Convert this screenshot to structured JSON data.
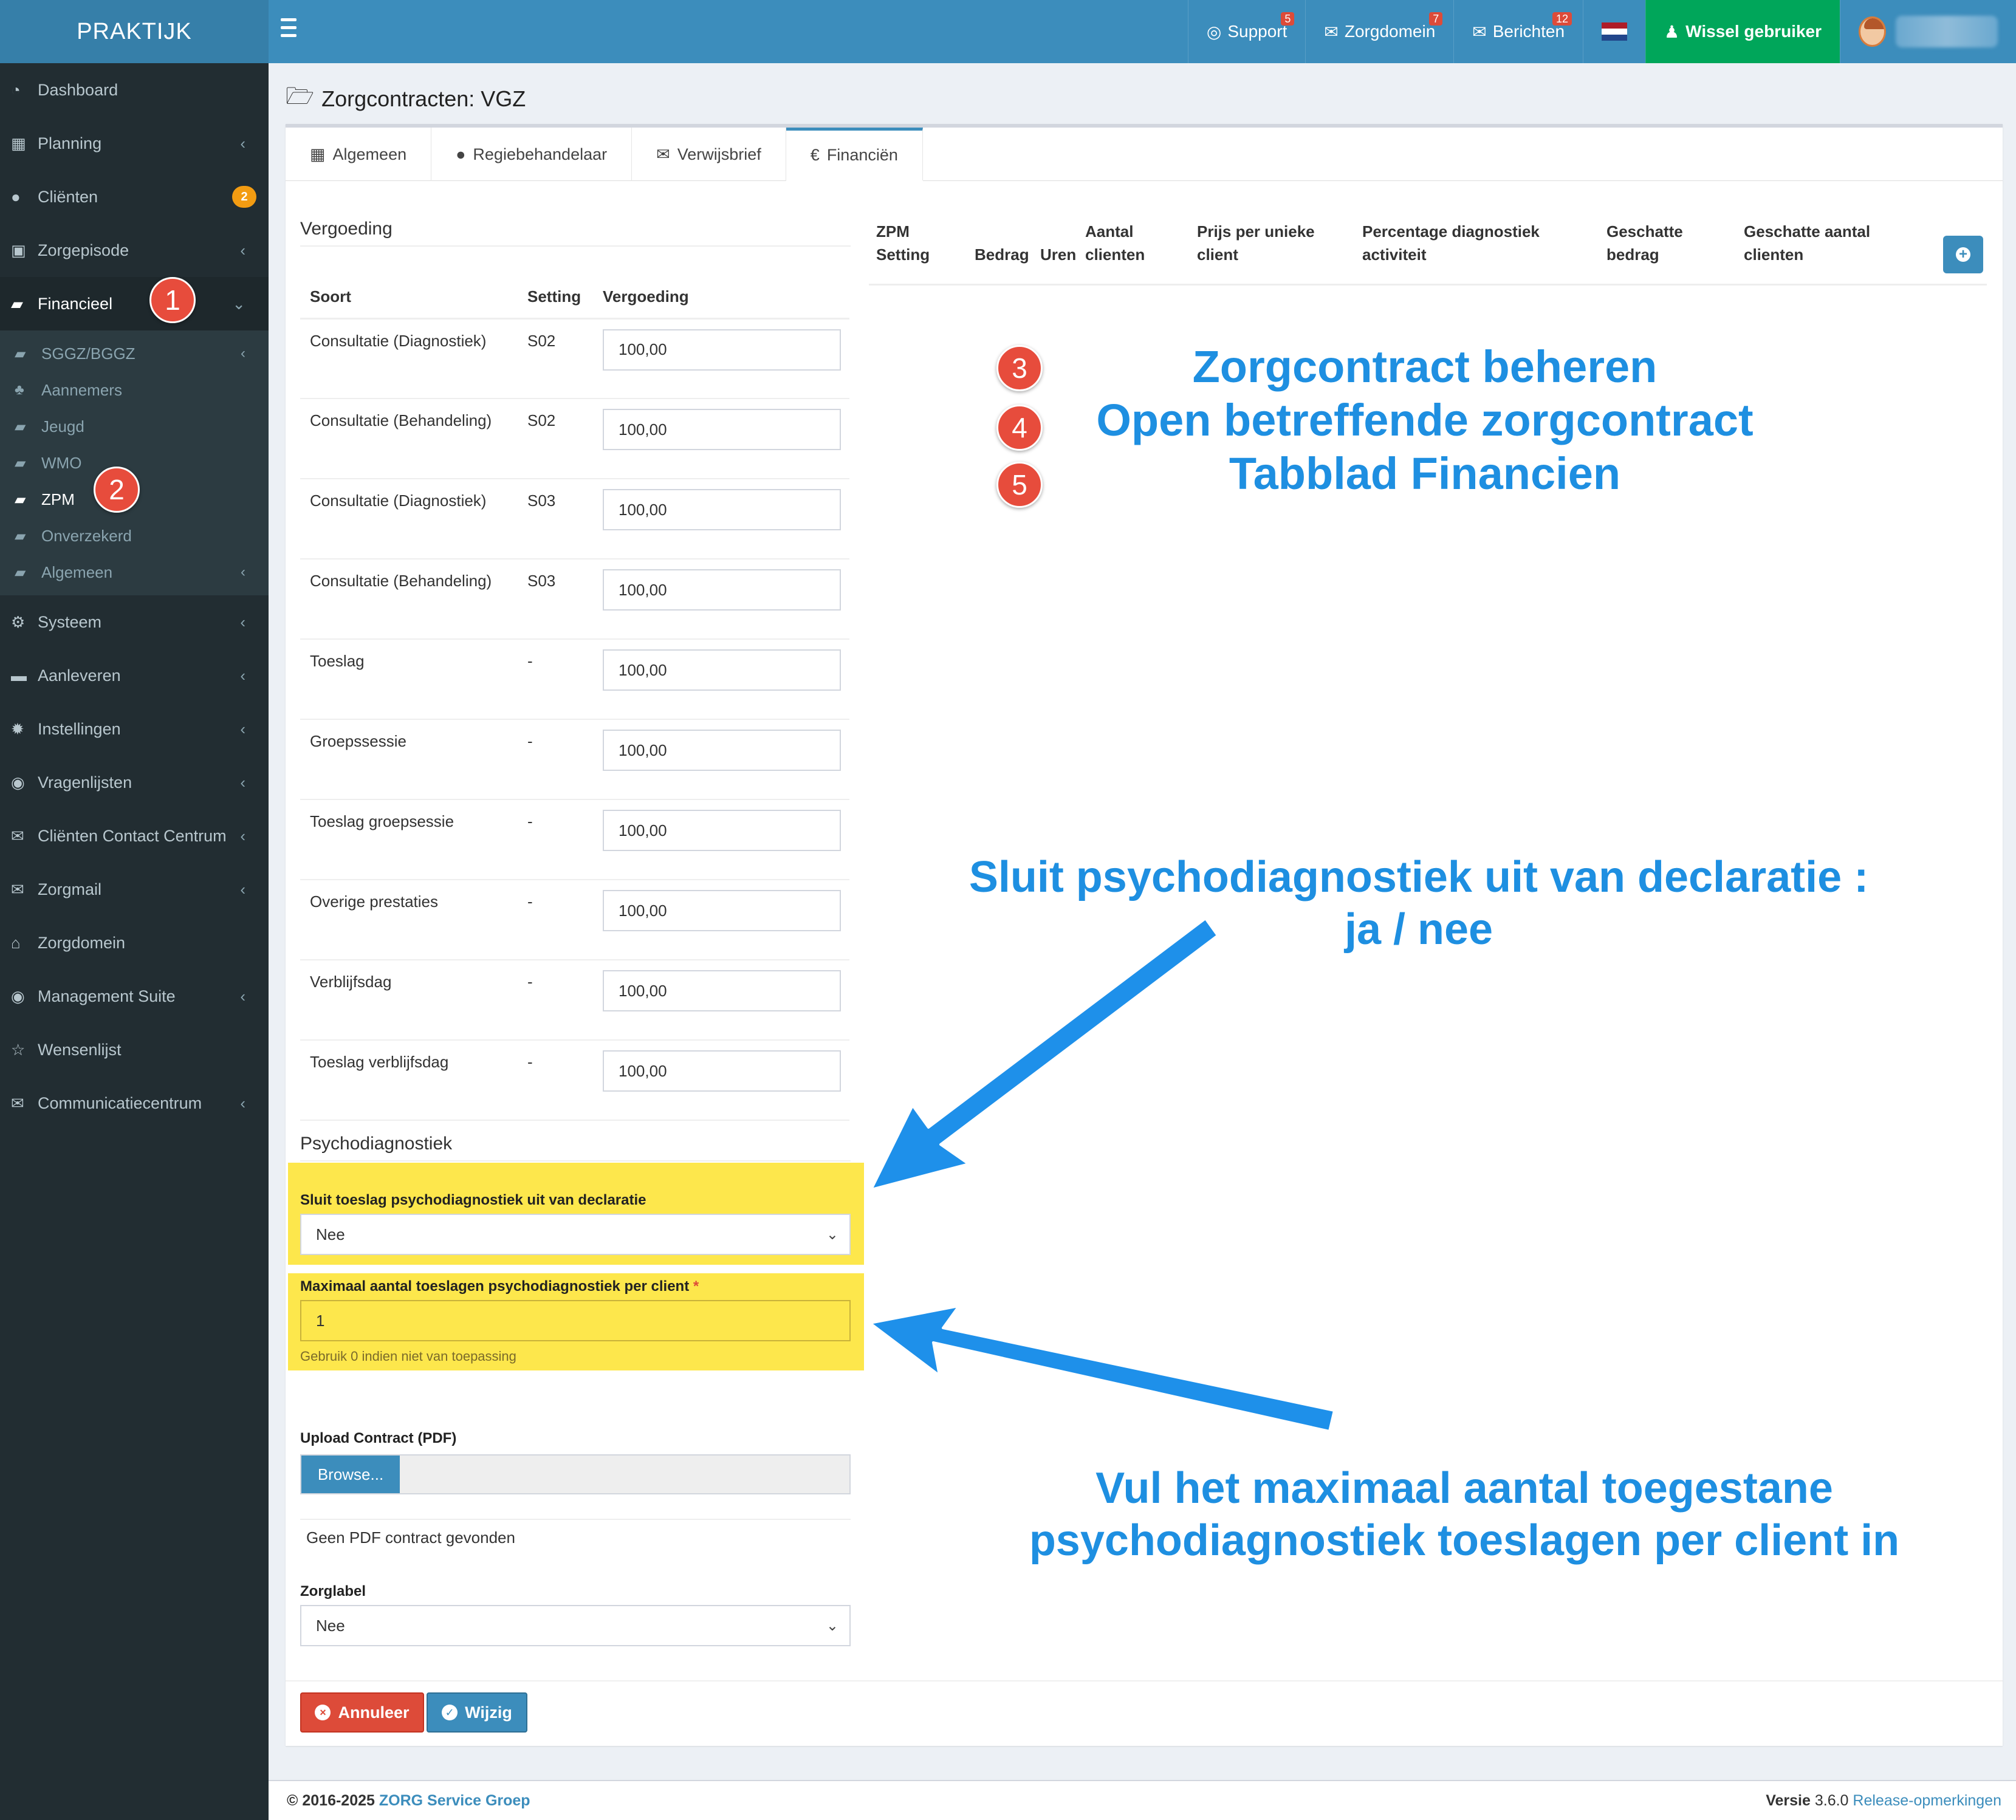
{
  "app": {
    "logo": "PRAKTIJK"
  },
  "topnav": {
    "support": {
      "label": "Support",
      "badge": "5"
    },
    "zorgdomein": {
      "label": "Zorgdomein",
      "badge": "7"
    },
    "berichten": {
      "label": "Berichten",
      "badge": "12"
    },
    "wissel": "Wissel gebruiker"
  },
  "sidebar": {
    "dashboard": "Dashboard",
    "planning": "Planning",
    "clienten": "Cliënten",
    "clienten_badge": "2",
    "zorgepisode": "Zorgepisode",
    "financieel": "Financieel",
    "sub": {
      "sggz": "SGGZ/BGGZ",
      "aannemers": "Aannemers",
      "jeugd": "Jeugd",
      "wmo": "WMO",
      "zpm": "ZPM",
      "onverzekerd": "Onverzekerd",
      "algemeen": "Algemeen"
    },
    "systeem": "Systeem",
    "aanleveren": "Aanleveren",
    "instellingen": "Instellingen",
    "vragenlijsten": "Vragenlijsten",
    "ccc": "Cliënten Contact Centrum",
    "zorgmail": "Zorgmail",
    "zorgdomein": "Zorgdomein",
    "management": "Management Suite",
    "wensenlijst": "Wensenlijst",
    "communicatie": "Communicatiecentrum"
  },
  "steps": {
    "s1": "1",
    "s2": "2",
    "s3": "3",
    "s4": "4",
    "s5": "5"
  },
  "page": {
    "title": "Zorgcontracten: VGZ"
  },
  "tabs": {
    "algemeen": "Algemeen",
    "regie": "Regiebehandelaar",
    "verwijsbrief": "Verwijsbrief",
    "financien": "Financiën"
  },
  "vergoeding": {
    "title": "Vergoeding",
    "headers": {
      "soort": "Soort",
      "setting": "Setting",
      "vergoeding": "Vergoeding"
    },
    "rows": [
      {
        "soort": "Consultatie (Diagnostiek)",
        "setting": "S02",
        "value": "100,00"
      },
      {
        "soort": "Consultatie (Behandeling)",
        "setting": "S02",
        "value": "100,00"
      },
      {
        "soort": "Consultatie (Diagnostiek)",
        "setting": "S03",
        "value": "100,00"
      },
      {
        "soort": "Consultatie (Behandeling)",
        "setting": "S03",
        "value": "100,00"
      },
      {
        "soort": "Toeslag",
        "setting": "-",
        "value": "100,00"
      },
      {
        "soort": "Groepssessie",
        "setting": "-",
        "value": "100,00"
      },
      {
        "soort": "Toeslag groepsessie",
        "setting": "-",
        "value": "100,00"
      },
      {
        "soort": "Overige prestaties",
        "setting": "-",
        "value": "100,00"
      },
      {
        "soort": "Verblijfsdag",
        "setting": "-",
        "value": "100,00"
      },
      {
        "soort": "Toeslag verblijfsdag",
        "setting": "-",
        "value": "100,00"
      }
    ]
  },
  "zpm": {
    "zpm_setting_1": "ZPM",
    "zpm_setting_2": "Setting",
    "bedrag": "Bedrag",
    "uren": "Uren",
    "aantal_1": "Aantal",
    "aantal_2": "clienten",
    "prijs_1": "Prijs per unieke",
    "prijs_2": "client",
    "perc_1": "Percentage diagnostiek",
    "perc_2": "activiteit",
    "geschat_bedrag_1": "Geschatte",
    "geschat_bedrag_2": "bedrag",
    "geschat_aantal_1": "Geschatte aantal",
    "geschat_aantal_2": "clienten"
  },
  "psycho": {
    "title": "Psychodiagnostiek",
    "sluit_label": "Sluit toeslag psychodiagnostiek uit van declaratie",
    "sluit_value": "Nee",
    "max_label": "Maximaal aantal toeslagen psychodiagnostiek per client",
    "max_required": "*",
    "max_value": "1",
    "max_help": "Gebruik 0 indien niet van toepassing"
  },
  "upload": {
    "label": "Upload Contract (PDF)",
    "browse": "Browse...",
    "none": "Geen PDF contract gevonden"
  },
  "zorglabel": {
    "label": "Zorglabel",
    "value": "Nee"
  },
  "buttons": {
    "annuleer": "Annuleer",
    "wijzig": "Wijzig"
  },
  "annotations": {
    "line1": "Zorgcontract beheren",
    "line2": "Open betreffende zorgcontract",
    "line3": "Tabblad Financien",
    "sluit_1": "Sluit psychodiagnostiek uit van declaratie :",
    "sluit_2": "ja / nee",
    "vul_1": "Vul het maximaal aantal toegestane",
    "vul_2": "psychodiagnostiek toeslagen per client in"
  },
  "footer": {
    "copyright": "© 2016-2025",
    "company": "ZORG Service Groep",
    "versie_label": "Versie",
    "versie": "3.6.0",
    "release": "Release-opmerkingen"
  },
  "colors": {
    "brand": "#3c8dbc",
    "sidebar": "#222d32",
    "highlight": "#fde74c",
    "annotation": "#1e8fe1",
    "step": "#e74c3c"
  }
}
